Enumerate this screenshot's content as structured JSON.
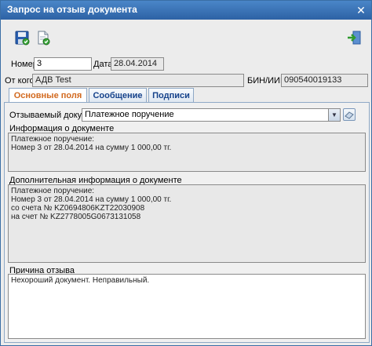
{
  "window": {
    "title": "Запрос на отзыв документа",
    "close_glyph": "✕"
  },
  "toolbar": {
    "save_icon": "save-floppy-icon",
    "doc_check_icon": "document-check-icon",
    "exit_icon": "exit-icon"
  },
  "header": {
    "number_label": "Номер",
    "number_value": "3",
    "date_label": "Дата",
    "date_value": "28.04.2014",
    "from_label": "От кого",
    "from_value": "АДВ Test",
    "bin_label": "БИН/ИИН",
    "bin_value": "090540019133"
  },
  "tabs": [
    {
      "label": "Основные поля",
      "active": true
    },
    {
      "label": "Сообщение",
      "active": false
    },
    {
      "label": "Подписи",
      "active": false
    }
  ],
  "main": {
    "recalled_doc_label": "Отзываемый документ",
    "recalled_doc_value": "Платежное поручение",
    "doc_info_label": "Информация о документе",
    "doc_info_text": "Платежное поручение:\nНомер 3 от 28.04.2014 на сумму 1 000,00 тг.",
    "extra_info_label": "Дополнительная информация о документе",
    "extra_info_text": "Платежное поручение:\nНомер 3 от 28.04.2014 на сумму 1 000,00 тг.\nсо счета № KZ0694806KZT22030908\nна счет № KZ2778005G0673131058",
    "reason_label": "Причина отзыва",
    "reason_text": "Нехороший документ. Неправильный."
  },
  "colors": {
    "title_bg": "#2d62a5",
    "active_tab_text": "#d2691e",
    "tab_text": "#15428b"
  }
}
